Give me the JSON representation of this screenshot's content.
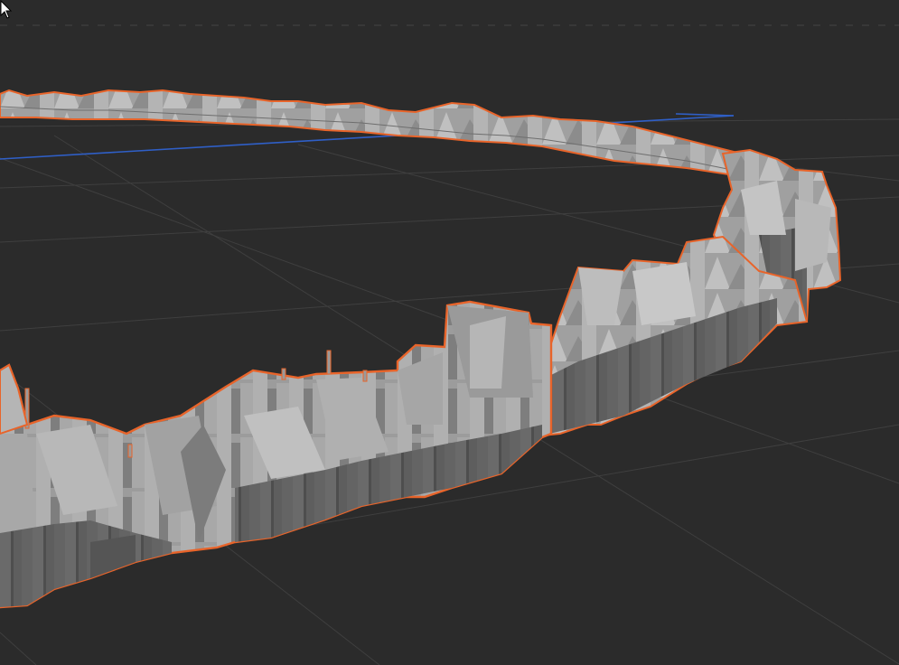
{
  "viewport": {
    "label": "",
    "background_color": "#2b2b2b",
    "grid_color": "#3f3f3f",
    "axis_color": "#2f5fc7",
    "selection_outline_color": "#e8642a",
    "building_light_color": "#a4a4a4",
    "building_mid_color": "#8a8a8a",
    "building_dark_color": "#5e5e5e",
    "object_name": "",
    "selected": true
  },
  "cursor": {
    "icon": "mouse-pointer-icon"
  }
}
